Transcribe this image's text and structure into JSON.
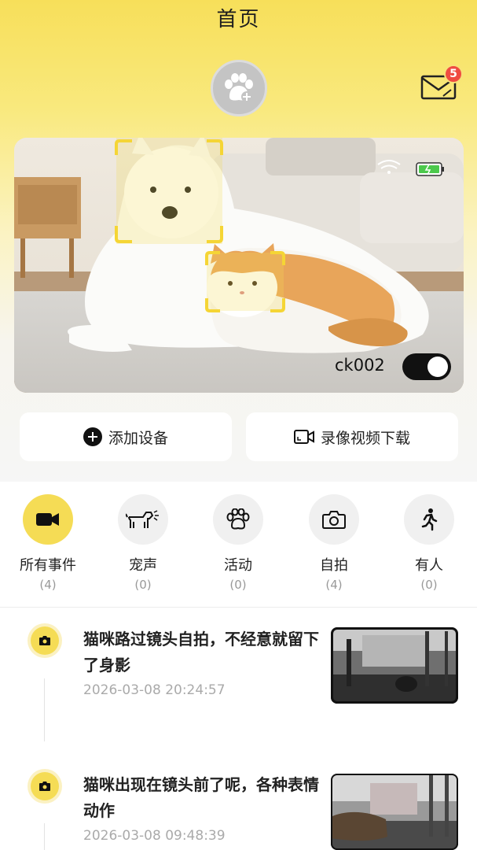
{
  "header": {
    "title": "首页"
  },
  "mail": {
    "badge_count": "5"
  },
  "camera": {
    "device_name": "ck002",
    "power_on": true
  },
  "actions": {
    "add_device": "添加设备",
    "download_video": "录像视频下载"
  },
  "filters": [
    {
      "label": "所有事件",
      "count": "(4)",
      "icon": "video-camera-icon",
      "active": true
    },
    {
      "label": "宠声",
      "count": "(0)",
      "icon": "barking-dog-icon",
      "active": false
    },
    {
      "label": "活动",
      "count": "(0)",
      "icon": "paw-icon",
      "active": false
    },
    {
      "label": "自拍",
      "count": "(4)",
      "icon": "camera-icon",
      "active": false
    },
    {
      "label": "有人",
      "count": "(0)",
      "icon": "walking-person-icon",
      "active": false
    }
  ],
  "events": [
    {
      "title": "猫咪路过镜头自拍，不经意就留下了身影",
      "time": "2026-03-08 20:24:57",
      "icon": "camera-icon"
    },
    {
      "title": "猫咪出现在镜头前了呢，各种表情动作",
      "time": "2026-03-08 09:48:39",
      "icon": "camera-icon"
    }
  ],
  "colors": {
    "accent": "#f5dc55",
    "badge": "#ef4b41"
  }
}
